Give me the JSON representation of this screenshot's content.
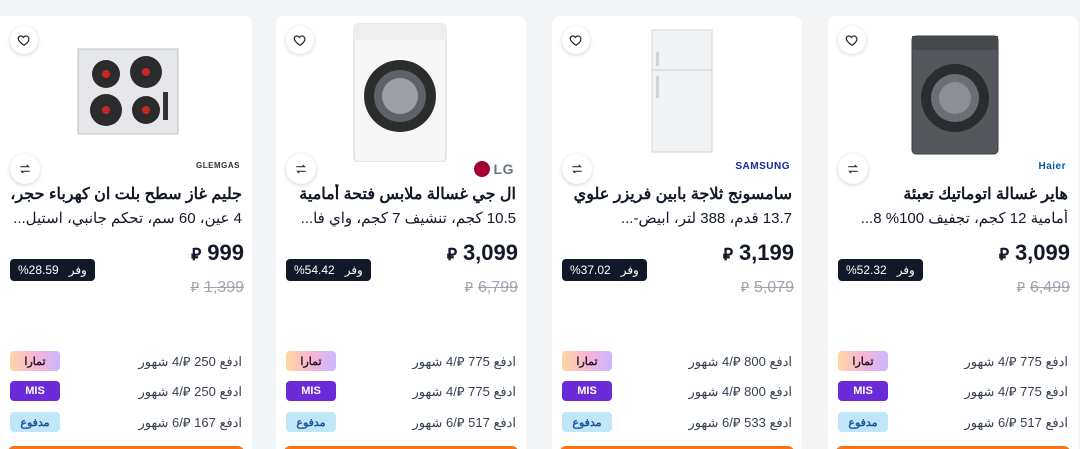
{
  "products": [
    {
      "brand": "GLEMGAS",
      "title": "جليم غاز سطح بلت ان كهرباء حجر،",
      "subtitle": "4 عين، 60 سم، تحكم جانبي، استيل...",
      "price": "999",
      "old_price": "1,399",
      "save_label": "وفر",
      "save_value": "%28.59",
      "plans": [
        {
          "text": "ادفع 250 ⃁/4 شهور",
          "logo": "تمارا"
        },
        {
          "text": "ادفع 250 ⃁/4 شهور",
          "logo": "MIS"
        },
        {
          "text": "ادفع 167 ⃁/6 شهور",
          "logo": "مدفوع"
        }
      ]
    },
    {
      "brand": "LG",
      "title": "ال جي غسالة ملابس فتحة أمامية",
      "subtitle": "10.5 كجم، تنشيف 7 كجم، واي فا...",
      "price": "3,099",
      "old_price": "6,799",
      "save_label": "وفر",
      "save_value": "%54.42",
      "plans": [
        {
          "text": "ادفع 775 ⃁/4 شهور",
          "logo": "تمارا"
        },
        {
          "text": "ادفع 775 ⃁/4 شهور",
          "logo": "MIS"
        },
        {
          "text": "ادفع 517 ⃁/6 شهور",
          "logo": "مدفوع"
        }
      ]
    },
    {
      "brand": "SAMSUNG",
      "title": "سامسونج ثلاجة بابين فريزر علوي",
      "subtitle": "13.7 قدم، 388 لتر، ابيض-...",
      "price": "3,199",
      "old_price": "5,079",
      "save_label": "وفر",
      "save_value": "%37.02",
      "plans": [
        {
          "text": "ادفع 800 ⃁/4 شهور",
          "logo": "تمارا"
        },
        {
          "text": "ادفع 800 ⃁/4 شهور",
          "logo": "MIS"
        },
        {
          "text": "ادفع 533 ⃁/6 شهور",
          "logo": "مدفوع"
        }
      ]
    },
    {
      "brand": "Haier",
      "title": "هاير غسالة اتوماتيك تعبئة",
      "subtitle": "أمامية 12 كجم، تجفيف 100% 8...",
      "price": "3,099",
      "old_price": "6,499",
      "save_label": "وفر",
      "save_value": "%52.32",
      "plans": [
        {
          "text": "ادفع 775 ⃁/4 شهور",
          "logo": "تمارا"
        },
        {
          "text": "ادفع 775 ⃁/4 شهور",
          "logo": "MIS"
        },
        {
          "text": "ادفع 517 ⃁/6 شهور",
          "logo": "مدفوع"
        }
      ]
    }
  ],
  "currency_symbol": "⃁",
  "colors": {
    "badge_bg": "#111827",
    "lg_red": "#a50034",
    "samsung_blue": "#1428a0",
    "haier_blue": "#005baa",
    "cta_orange": "#f97316"
  }
}
